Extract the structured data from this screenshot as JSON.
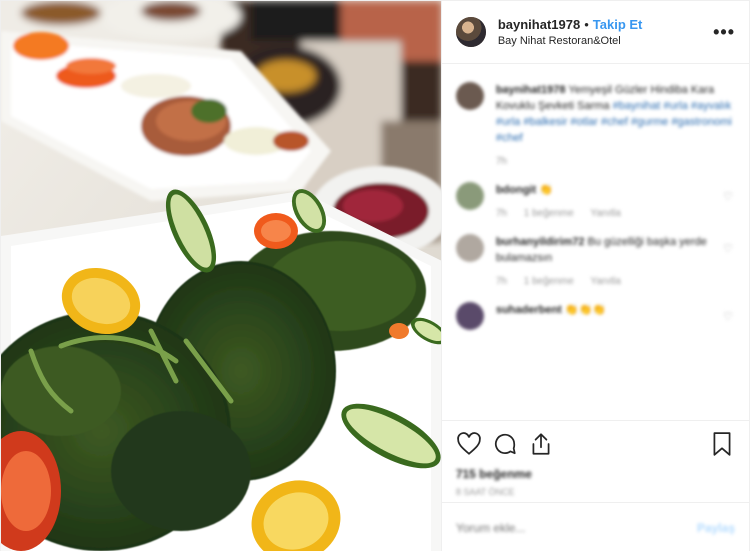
{
  "header": {
    "username": "baynihat1978",
    "separator": "•",
    "follow_label": "Takip Et",
    "location": "Bay Nihat Restoran&Otel",
    "more_label": "•••"
  },
  "comments": [
    {
      "avatar_color": "#6b5a50",
      "user": "baynihat1978",
      "text": "Yemyeşil Güzler Hindiba Kara Kovuklu Şevketi Sarma",
      "tags": "#baynihat #urla #ayvalık #urla #balkesir #otlar #chef #gurme #gastronomi #chef",
      "meta": [
        "7h"
      ]
    },
    {
      "avatar_color": "#8a9a7a",
      "user": "bdongit",
      "text": "👏",
      "meta": [
        "7h",
        "1 beğenme",
        "Yanıtla"
      ]
    },
    {
      "avatar_color": "#b0a8a0",
      "user": "burhanyildirim72",
      "text": "Bu güzelliği başka yerde bulamazsın",
      "meta": [
        "7h",
        "1 beğenme",
        "Yanıtla"
      ]
    },
    {
      "avatar_color": "#5a4a6a",
      "user": "suhaderbent",
      "text": "👏👏👏",
      "meta": []
    }
  ],
  "actions": {
    "likes": "715 beğenme",
    "time_ago": "8 saat önce"
  },
  "add_comment": {
    "placeholder": "Yorum ekle...",
    "post_label": "Paylaş"
  },
  "colors": {
    "follow_blue": "#3897f0",
    "post_disabled": "#b3dbff",
    "border": "#efefef"
  }
}
